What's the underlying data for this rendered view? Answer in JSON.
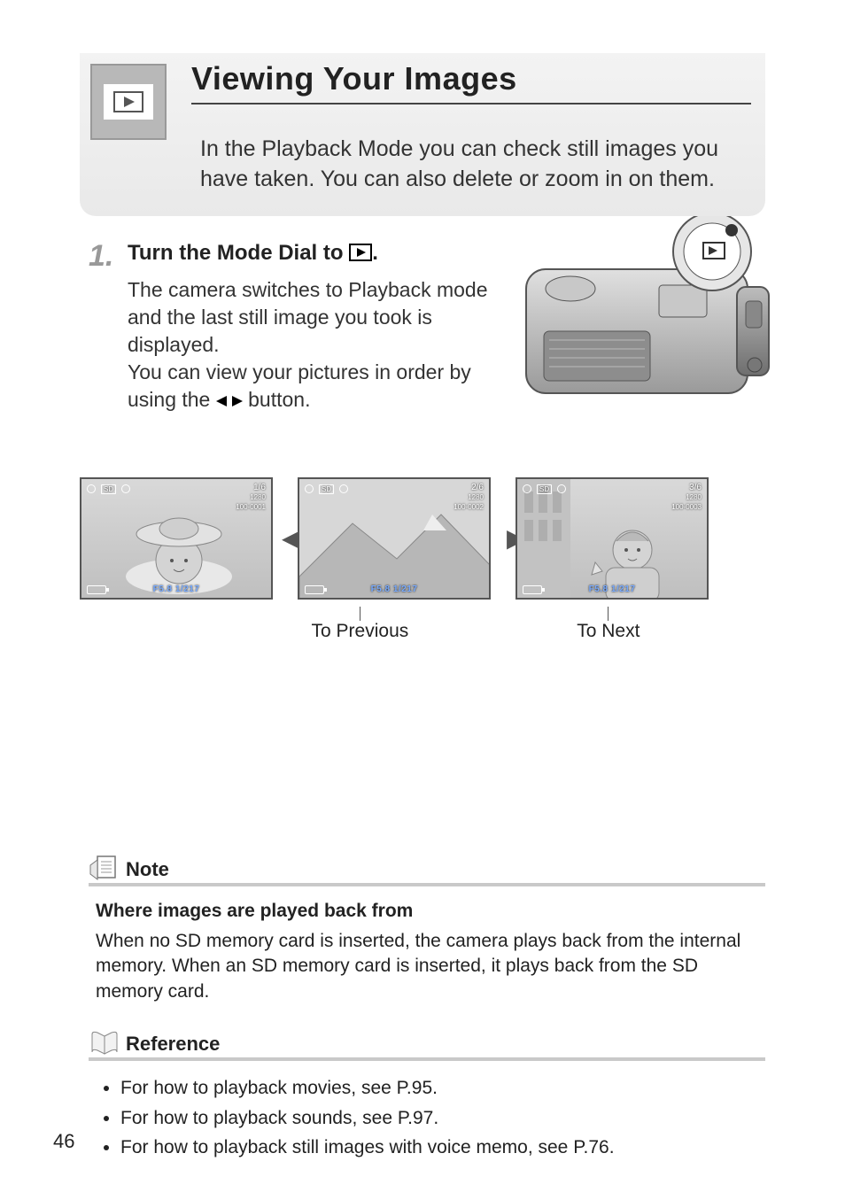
{
  "header": {
    "title": "Viewing Your Images",
    "intro": "In the Playback Mode you can check still images you have taken. You can also delete or zoom in on them."
  },
  "steps": {
    "s1": {
      "num": "1.",
      "head_prefix": "Turn the Mode Dial to ",
      "head_suffix": ".",
      "body1": "The camera switches to Playback mode and the last still image you took is displayed.",
      "body2_prefix": "You can view your pictures in order by using the ",
      "body2_suffix": " button."
    }
  },
  "playback": {
    "prev": "To Previous",
    "next": "To Next",
    "lcd1": {
      "count": "1/6",
      "size": "1280",
      "file": "100-0001",
      "fstop": "F5.8 1/217",
      "sd": "SD"
    },
    "lcd2": {
      "count": "2/6",
      "size": "1280",
      "file": "100-0002",
      "fstop": "F5.8 1/217",
      "sd": "SD"
    },
    "lcd3": {
      "count": "3/6",
      "size": "1280",
      "file": "100-0003",
      "fstop": "F5.8 1/217",
      "sd": "SD"
    }
  },
  "note": {
    "label": "Note",
    "subhead": "Where images are played back from",
    "body": "When no SD memory card is inserted, the camera plays back from the internal memory. When an SD memory card is inserted, it plays back from the SD memory card."
  },
  "reference": {
    "label": "Reference",
    "items": [
      "For how to playback movies, see P.95.",
      "For how to playback sounds, see P.97.",
      "For how to playback still images with voice memo, see P.76."
    ]
  },
  "page_number": "46"
}
